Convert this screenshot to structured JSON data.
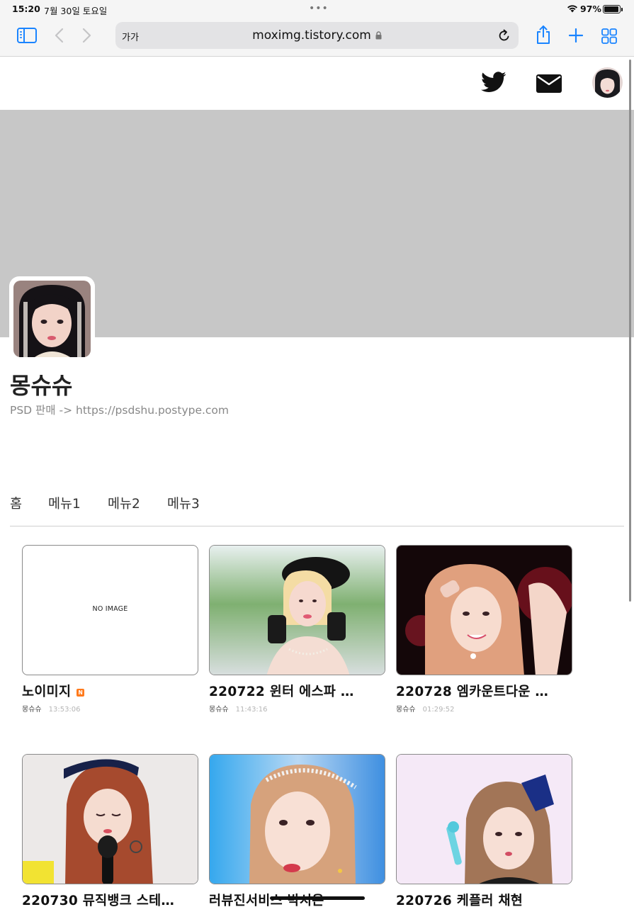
{
  "status_bar": {
    "time": "15:20",
    "date": "7월 30일 토요일",
    "battery": "97%",
    "battery_level": 0.97
  },
  "toolbar": {
    "text_size_label": "가가",
    "url": "moximg.tistory.com"
  },
  "blog": {
    "name": "몽슈슈",
    "description": "PSD 판매 -> https://psdshu.postype.com"
  },
  "nav": {
    "items": [
      "홈",
      "메뉴1",
      "메뉴2",
      "메뉴3"
    ]
  },
  "posts": [
    {
      "title": "노이미지",
      "author": "몽슈슈",
      "time": "13:53:06",
      "thumb": "NO IMAGE",
      "is_new": true,
      "new_badge": "N"
    },
    {
      "title": "220722 윈터 에스파 …",
      "author": "몽슈슈",
      "time": "11:43:16"
    },
    {
      "title": "220728 엠카운트다운 …",
      "author": "몽슈슈",
      "time": "01:29:52"
    },
    {
      "title": "220730 뮤직뱅크 스테…"
    },
    {
      "title": "러뷰진서비스 박시은"
    },
    {
      "title": "220726 케플러 채현"
    }
  ],
  "colors": {
    "new_badge": "#ff7a1c",
    "cover": "#c7c7c7",
    "safari_blue": "#1a84ff"
  }
}
